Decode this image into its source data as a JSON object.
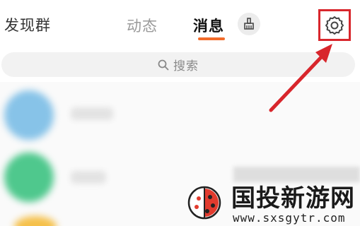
{
  "header": {
    "discover_group": "发现群",
    "tabs": [
      {
        "label": "动态",
        "active": false
      },
      {
        "label": "消息",
        "active": true
      }
    ],
    "accent_color": "#f26b2a",
    "cleanup_icon": "broom-icon",
    "settings_icon": "gear-icon"
  },
  "search": {
    "placeholder": "搜索",
    "icon": "search-icon"
  },
  "annotation": {
    "highlight_color": "#d8262c"
  },
  "watermark": {
    "title": "国投新游网",
    "url": "www.sxsgytr.com"
  }
}
